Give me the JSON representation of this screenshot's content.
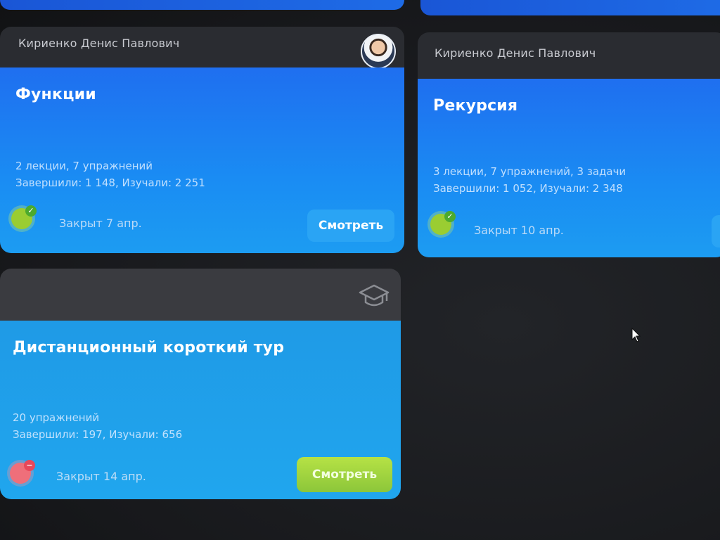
{
  "cards": [
    {
      "author": "Кириенко Денис Павлович",
      "title": "Функции",
      "meta_line1": "2 лекции, 7 упражнений",
      "meta_line2": "Завершили: 1 148, Изучали: 2 251",
      "closed": "Закрыт 7 апр.",
      "button": "Смотреть",
      "status": "completed"
    },
    {
      "author": "Кириенко Денис Павлович",
      "title": "Рекурсия",
      "meta_line1": "3 лекции, 7 упражнений, 3 задачи",
      "meta_line2": "Завершили: 1 052, Изучали: 2 348",
      "closed": "Закрыт 10 апр.",
      "status": "completed"
    },
    {
      "title": "Дистанционный короткий тур",
      "meta_line1": "20 упражнений",
      "meta_line2": "Завершили: 197, Изучали: 656",
      "closed": "Закрыт 14 апр.",
      "button": "Смотреть",
      "status": "not-completed",
      "header_icon": "graduation-cap-icon"
    }
  ],
  "colors": {
    "card_blue": "#1f6ff0",
    "card_cyan": "#1c9cf2",
    "button_blue": "#2aa4f4",
    "button_green": "#8cc63a",
    "status_green": "#9acd32",
    "status_pink": "#ef6f7a",
    "background": "#1a1b1f"
  }
}
